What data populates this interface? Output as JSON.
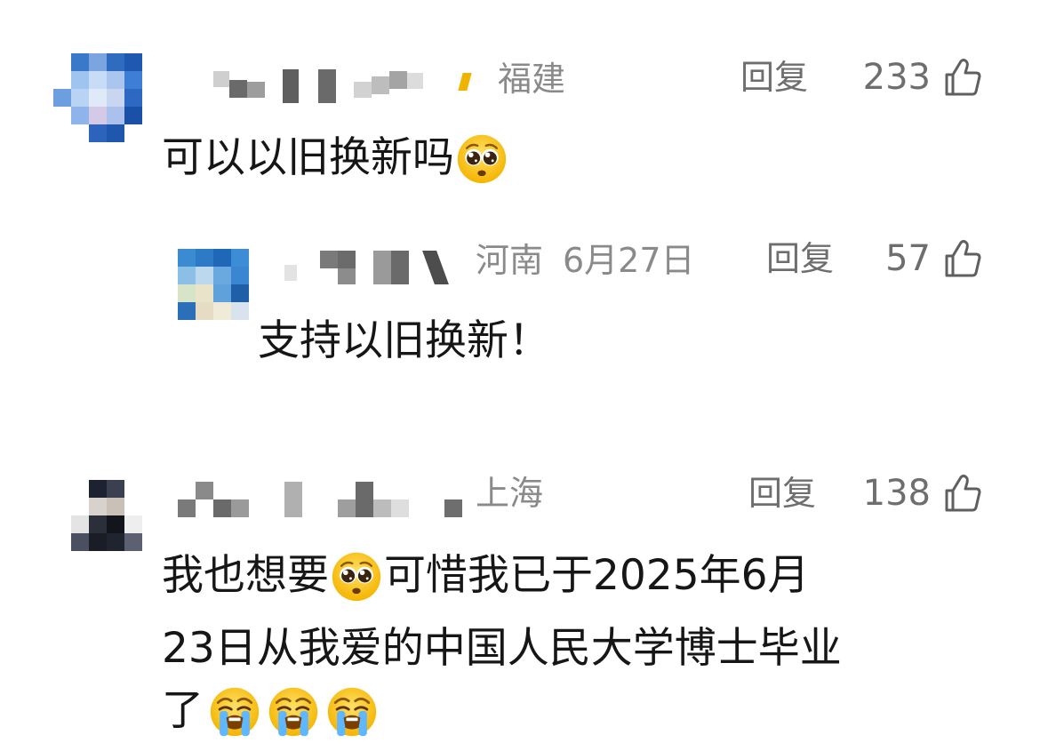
{
  "reply_label": "回复",
  "comments": [
    {
      "location": "福建",
      "likes": "233",
      "text_before_emoji": "可以以旧换新吗",
      "emoji": "pleading-face"
    },
    {
      "location": "河南",
      "date": "6月27日",
      "likes": "57",
      "text": "支持以旧换新！"
    },
    {
      "location": "上海",
      "likes": "138",
      "line1_a": "我也想要",
      "line1_emoji": "pleading-face",
      "line1_b": "可惜我已于2025年6月",
      "line2": "23日从我爱的中国人民大学博士毕业",
      "line3": "了",
      "line3_emojis": [
        "loudly-crying-face",
        "loudly-crying-face",
        "loudly-crying-face"
      ]
    }
  ],
  "colors": {
    "meta_gray": "#8a8a8a",
    "action_gray": "#6e6e6e",
    "text": "#161616"
  }
}
